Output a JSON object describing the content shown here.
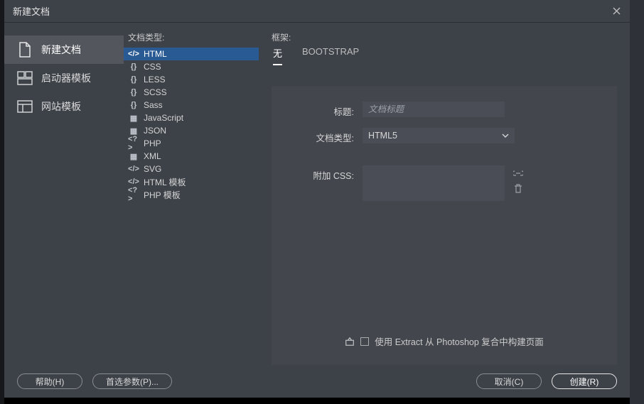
{
  "window": {
    "title": "新建文档"
  },
  "sidebar": {
    "items": [
      {
        "label": "新建文档",
        "icon": "file"
      },
      {
        "label": "启动器模板",
        "icon": "launcher"
      },
      {
        "label": "网站模板",
        "icon": "site"
      }
    ],
    "selected": 0
  },
  "docTypes": {
    "header": "文档类型:",
    "selected": 0,
    "items": [
      {
        "icon": "</>",
        "label": "HTML"
      },
      {
        "icon": "{}",
        "label": "CSS"
      },
      {
        "icon": "{}",
        "label": "LESS"
      },
      {
        "icon": "{}",
        "label": "SCSS"
      },
      {
        "icon": "{}",
        "label": "Sass"
      },
      {
        "icon": "▦",
        "label": "JavaScript"
      },
      {
        "icon": "▦",
        "label": "JSON"
      },
      {
        "icon": "<?>",
        "label": "PHP"
      },
      {
        "icon": "▦",
        "label": "XML"
      },
      {
        "icon": "</>",
        "label": "SVG"
      },
      {
        "icon": "</>",
        "label": "HTML 模板"
      },
      {
        "icon": "<?>",
        "label": "PHP 模板"
      }
    ]
  },
  "frame": {
    "header": "框架:",
    "tabs": [
      "无",
      "BOOTSTRAP"
    ],
    "selected": 0
  },
  "form": {
    "title_label": "标题:",
    "title_placeholder": "文档标题",
    "title_value": "",
    "doctype_label": "文档类型:",
    "doctype_value": "HTML5",
    "css_label": "附加 CSS:",
    "extract_text": "使用 Extract 从 Photoshop 复合中构建页面"
  },
  "footer": {
    "help": "帮助(H)",
    "prefs": "首选参数(P)...",
    "cancel": "取消(C)",
    "create": "创建(R)"
  }
}
